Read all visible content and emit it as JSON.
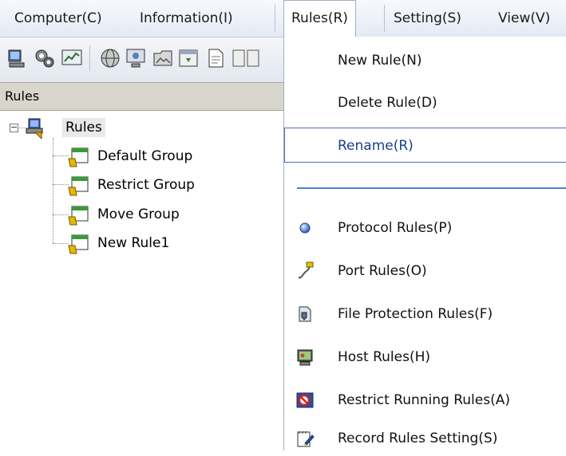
{
  "menubar": {
    "items": [
      {
        "label": "Computer(C)"
      },
      {
        "label": "Information(I)"
      },
      {
        "label": "Rules(R)"
      },
      {
        "label": "Setting(S)"
      },
      {
        "label": "View(V)"
      }
    ]
  },
  "toolbar": {
    "icons": [
      "computer-icon",
      "gears-icon",
      "monitor-chart-icon",
      "globe-icon",
      "screen-icon",
      "folder-image-icon",
      "window-icon",
      "document-icon"
    ]
  },
  "panel": {
    "title": "Rules"
  },
  "tree": {
    "root": "Rules",
    "children": [
      "Default Group",
      "Restrict Group",
      "Move Group",
      "New Rule1"
    ]
  },
  "dropdown": {
    "items": [
      {
        "label": "New Rule(N)"
      },
      {
        "label": "Delete Rule(D)"
      },
      {
        "label": "Rename(R)"
      },
      {
        "label": "Protocol Rules(P)",
        "icon": "blue-sphere-icon"
      },
      {
        "label": "Port Rules(O)",
        "icon": "cable-plug-icon"
      },
      {
        "label": "File Protection Rules(F)",
        "icon": "file-shield-icon"
      },
      {
        "label": "Host Rules(H)",
        "icon": "host-computer-icon"
      },
      {
        "label": "Restrict Running Rules(A)",
        "icon": "no-entry-icon"
      },
      {
        "label": "Record Rules Setting(S)",
        "icon": "notepad-pen-icon"
      }
    ]
  }
}
